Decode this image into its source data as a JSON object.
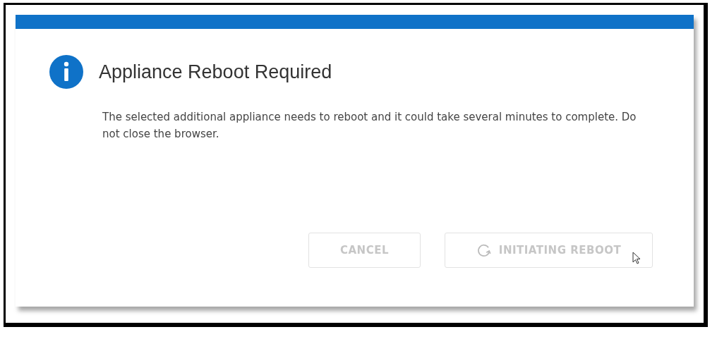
{
  "dialog": {
    "title": "Appliance Reboot Required",
    "message": "The selected additional appliance needs to reboot and it could take several minutes to complete. Do not close the browser.",
    "buttons": [
      {
        "kind": "secondary",
        "label": "CANCEL",
        "disabled": true
      },
      {
        "kind": "primary",
        "label": "INITIATING REBOOT",
        "disabled": true,
        "busy": true
      }
    ]
  }
}
